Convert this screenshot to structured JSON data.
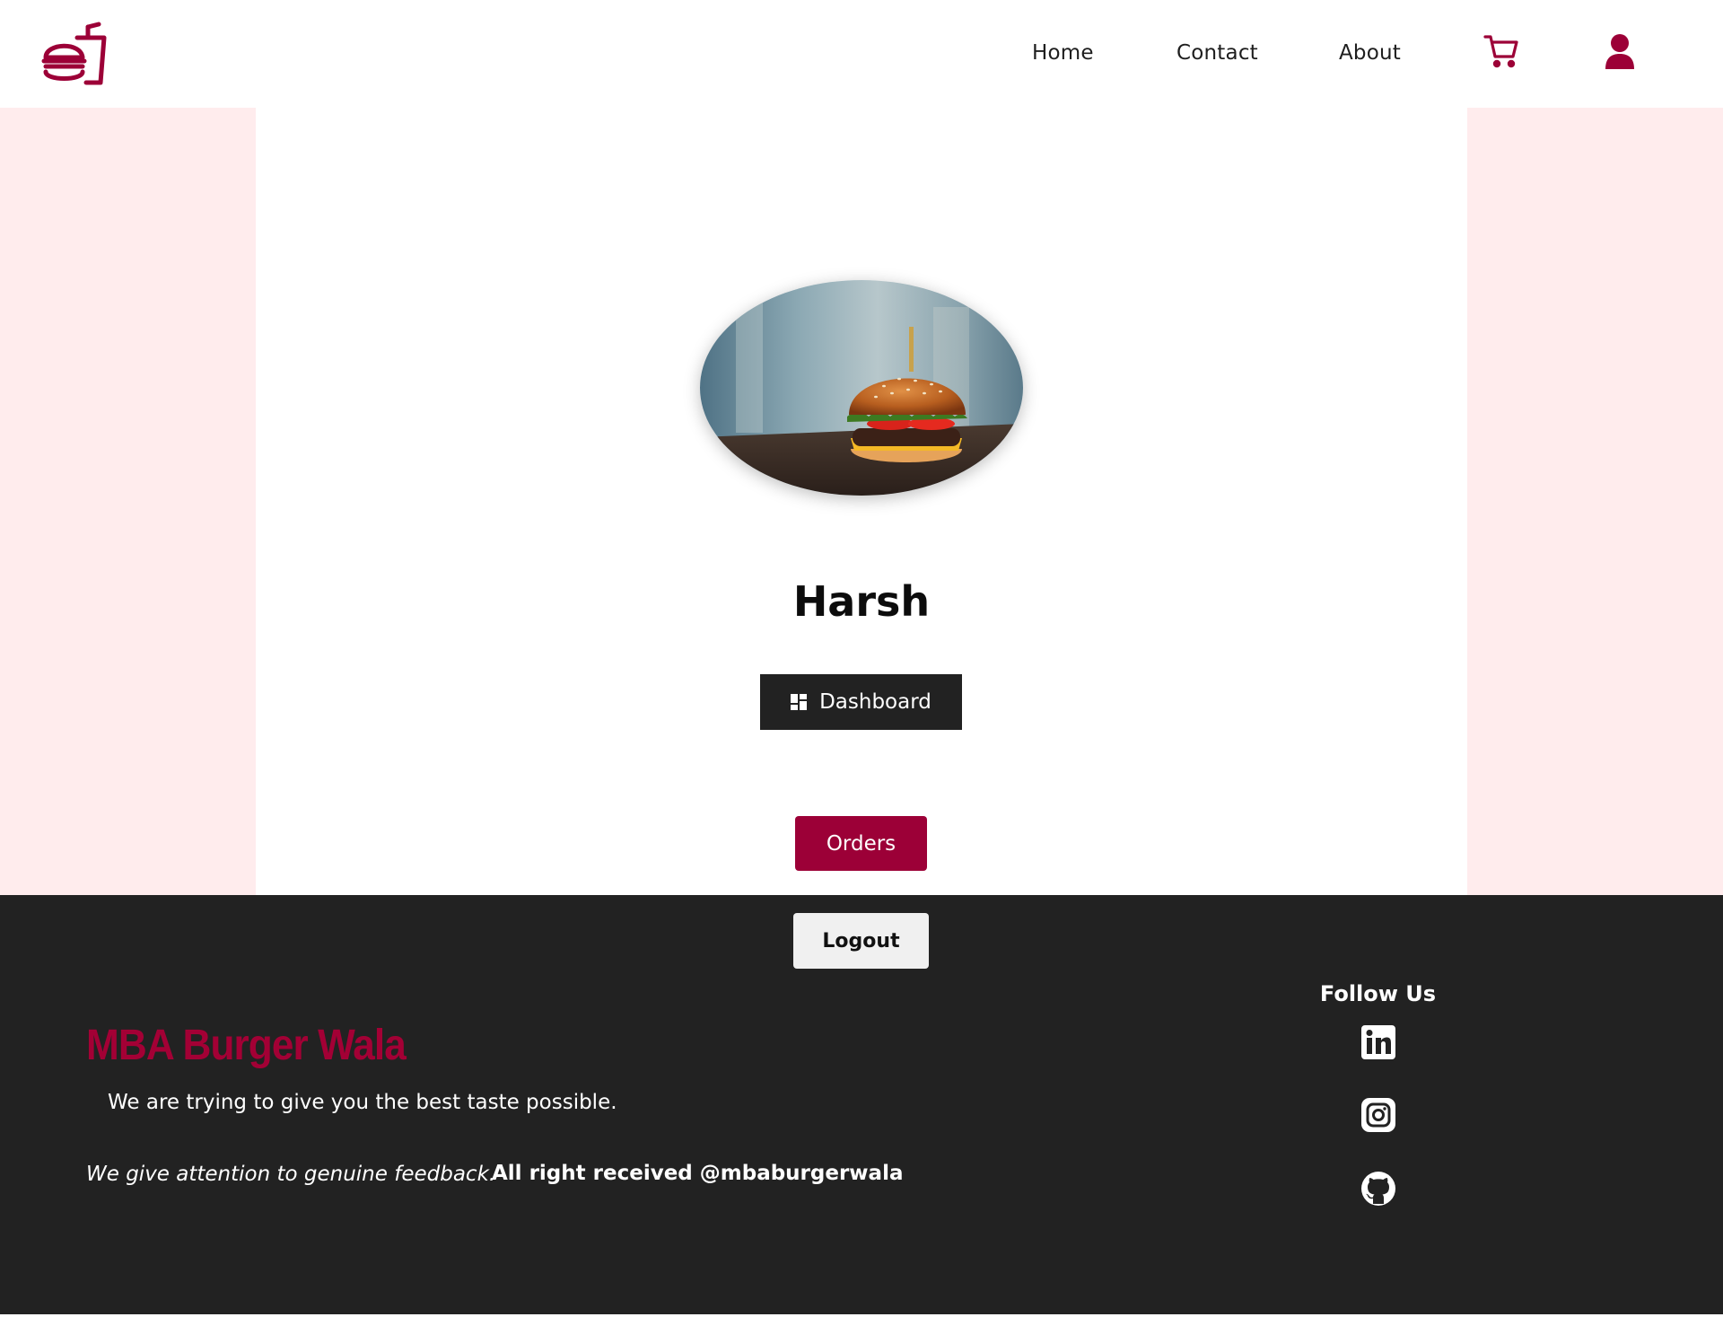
{
  "header": {
    "logo_icon": "burger-and-drink-icon",
    "nav": {
      "home": "Home",
      "contact": "Contact",
      "about": "About"
    },
    "cart_icon": "cart-icon",
    "user_icon": "user-icon"
  },
  "profile": {
    "avatar_description_icon": "burger-photo",
    "name": "Harsh",
    "dashboard_label": "Dashboard",
    "dashboard_icon": "dashboard-grid-icon",
    "orders_label": "Orders",
    "logout_label": "Logout"
  },
  "footer": {
    "brand": "MBA Burger Wala",
    "tagline": "We are trying to give you the best taste possible.",
    "feedback": "We give attention to genuine feedback.",
    "rights": "All right received @mbaburgerwala",
    "follow_title": "Follow Us",
    "social_icons": [
      "linkedin-icon",
      "instagram-icon",
      "github-icon"
    ]
  },
  "colors": {
    "brand": "#9c0037",
    "side_background": "#ffeced",
    "footer_background": "#222222",
    "dashboard_button": "#222222",
    "logout_button": "#f0f0f0"
  }
}
